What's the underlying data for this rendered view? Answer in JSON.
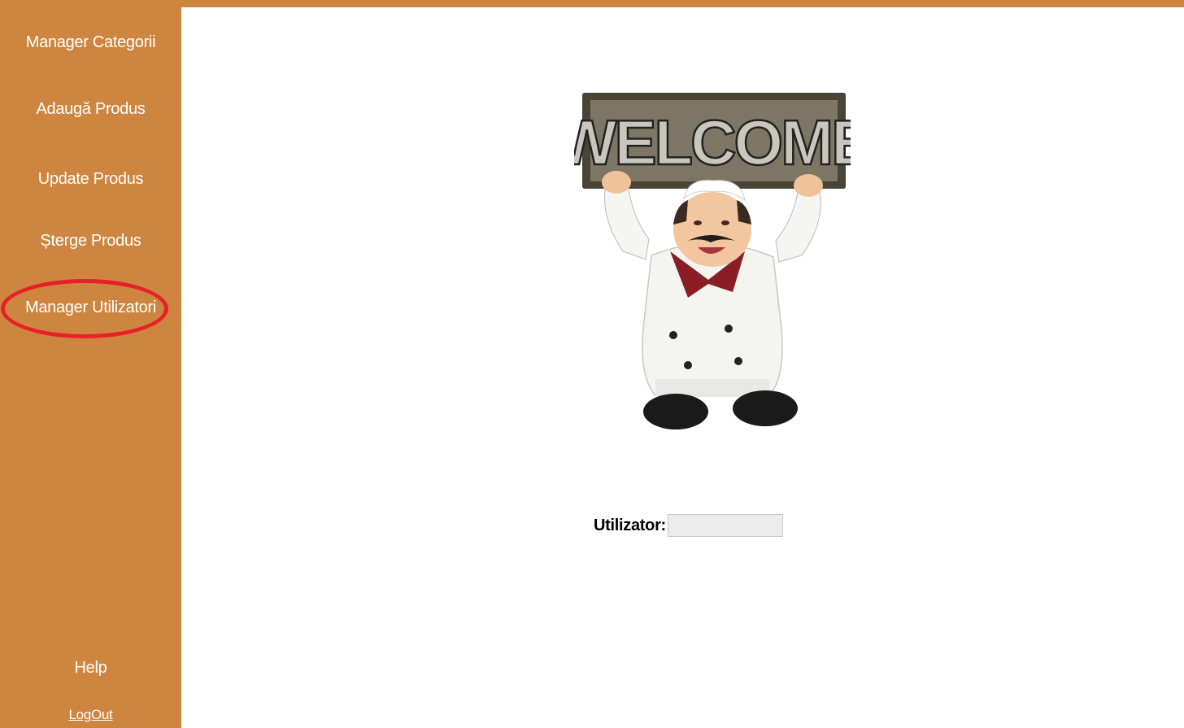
{
  "sidebar": {
    "items": [
      {
        "label": "Manager Categorii"
      },
      {
        "label": "Adaugă Produs"
      },
      {
        "label": "Update Produs"
      },
      {
        "label": "Șterge Produs"
      },
      {
        "label": "Manager Utilizatori"
      }
    ],
    "help_label": "Help",
    "logout_label": "LogOut"
  },
  "main": {
    "welcome_sign_text": "WELCOME",
    "user_label": "Utilizator:",
    "user_input_value": "",
    "user_input_placeholder": ""
  },
  "colors": {
    "sidebar_bg": "#cd853f",
    "highlight_ring": "#e8202a"
  }
}
